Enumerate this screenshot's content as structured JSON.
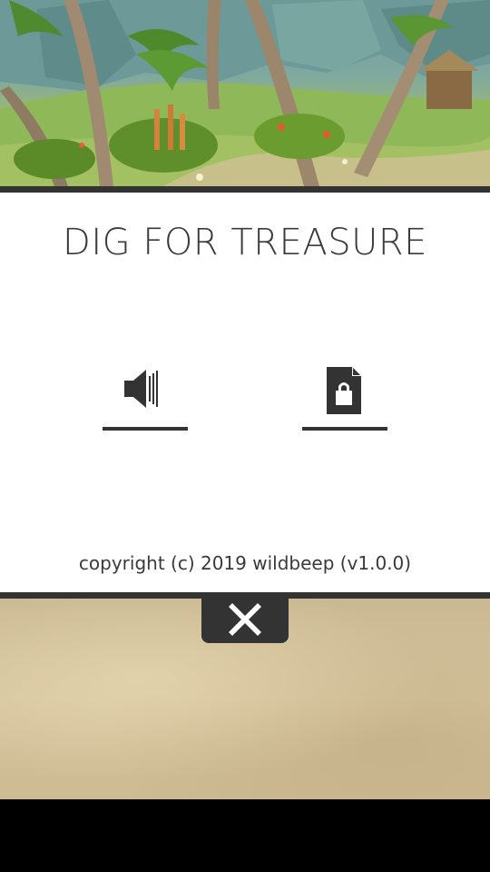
{
  "menu": {
    "title": "DIG FOR TREASURE",
    "copyright": "copyright (c) 2019 wildbeep (v1.0.0)",
    "options": [
      {
        "icon": "speaker-icon"
      },
      {
        "icon": "document-lock-icon"
      }
    ],
    "close_icon": "close-icon"
  },
  "colors": {
    "dark_bar": "#333333",
    "text": "#3a3a3a",
    "panel_bg": "#ffffff",
    "sand": "#d2c19a"
  }
}
